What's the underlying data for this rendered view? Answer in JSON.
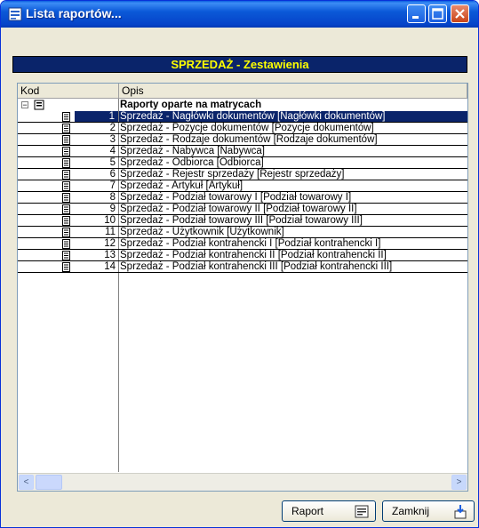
{
  "window": {
    "title": "Lista raportów..."
  },
  "header": {
    "title": "SPRZEDAŻ - Zestawienia"
  },
  "columns": {
    "kod": "Kod",
    "opis": "Opis"
  },
  "group": {
    "label": "Raporty oparte na matrycach",
    "expander": "−"
  },
  "rows": [
    {
      "num": "1",
      "desc": "Sprzedaż - Nagłówki dokumentów [Nagłówki dokumentów]"
    },
    {
      "num": "2",
      "desc": "Sprzedaż - Pozycje dokumentów [Pozycje dokumentów]"
    },
    {
      "num": "3",
      "desc": "Sprzedaż - Rodzaje dokumentów [Rodzaje dokumentów]"
    },
    {
      "num": "4",
      "desc": "Sprzedaż - Nabywca [Nabywca]"
    },
    {
      "num": "5",
      "desc": "Sprzedaż - Odbiorca [Odbiorca]"
    },
    {
      "num": "6",
      "desc": "Sprzedaż - Rejestr sprzedaży [Rejestr sprzedaży]"
    },
    {
      "num": "7",
      "desc": "Sprzedaż - Artykuł [Artykuł]"
    },
    {
      "num": "8",
      "desc": "Sprzedaż - Podział towarowy I [Podział towarowy I]"
    },
    {
      "num": "9",
      "desc": "Sprzedaż - Podział towarowy II [Podział towarowy II]"
    },
    {
      "num": "10",
      "desc": "Sprzedaż - Podział towarowy III [Podział towarowy III]"
    },
    {
      "num": "11",
      "desc": "Sprzedaż - Użytkownik [Użytkownik]"
    },
    {
      "num": "12",
      "desc": "Sprzedaż - Podział kontrahencki I [Podział kontrahencki I]"
    },
    {
      "num": "13",
      "desc": "Sprzedaż - Podział kontrahencki II [Podział kontrahencki II]"
    },
    {
      "num": "14",
      "desc": "Sprzedaż - Podział kontrahencki III [Podział kontrahencki III]"
    }
  ],
  "buttons": {
    "raport": "Raport",
    "zamknij": "Zamknij"
  },
  "scroll": {
    "left": "<",
    "right": ">"
  }
}
